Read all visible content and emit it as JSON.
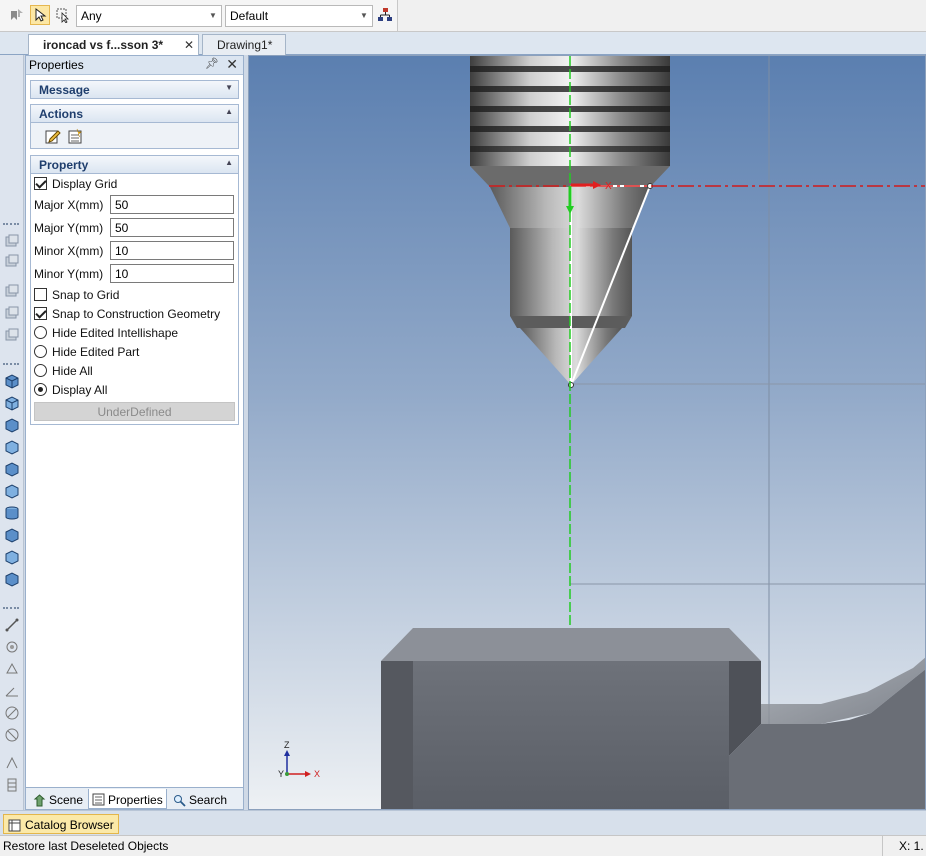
{
  "toolbar": {
    "filter_value": "Any",
    "style_value": "Default"
  },
  "doc_tabs": [
    {
      "label": "ironcad vs f...sson 3*"
    },
    {
      "label": "Drawing1*"
    }
  ],
  "properties_panel": {
    "title": "Properties",
    "sections": {
      "message": "Message",
      "actions": "Actions",
      "property": "Property"
    },
    "display_grid": {
      "label": "Display Grid",
      "checked": true
    },
    "fields": [
      {
        "label": "Major X(mm)",
        "value": "50"
      },
      {
        "label": "Major Y(mm)",
        "value": "50"
      },
      {
        "label": "Minor X(mm)",
        "value": "10"
      },
      {
        "label": "Minor Y(mm)",
        "value": "10"
      }
    ],
    "snap_to_grid": {
      "label": "Snap to Grid",
      "checked": false
    },
    "snap_to_construction": {
      "label": "Snap to Construction Geometry",
      "checked": true
    },
    "radios": [
      {
        "label": "Hide Edited Intellishape",
        "checked": false
      },
      {
        "label": "Hide Edited Part",
        "checked": false
      },
      {
        "label": "Hide All",
        "checked": false
      },
      {
        "label": "Display All",
        "checked": true
      }
    ],
    "status_button": "UnderDefined",
    "bottom_tabs": [
      {
        "label": "Scene"
      },
      {
        "label": "Properties"
      },
      {
        "label": "Search"
      }
    ]
  },
  "viewport": {
    "axis_labels": {
      "x": "X",
      "y": "Y",
      "z": "Z",
      "x_small": "X"
    }
  },
  "catalog_browser": "Catalog Browser",
  "status": {
    "message": "Restore last Deseleted Objects",
    "coords": "X: 1."
  }
}
